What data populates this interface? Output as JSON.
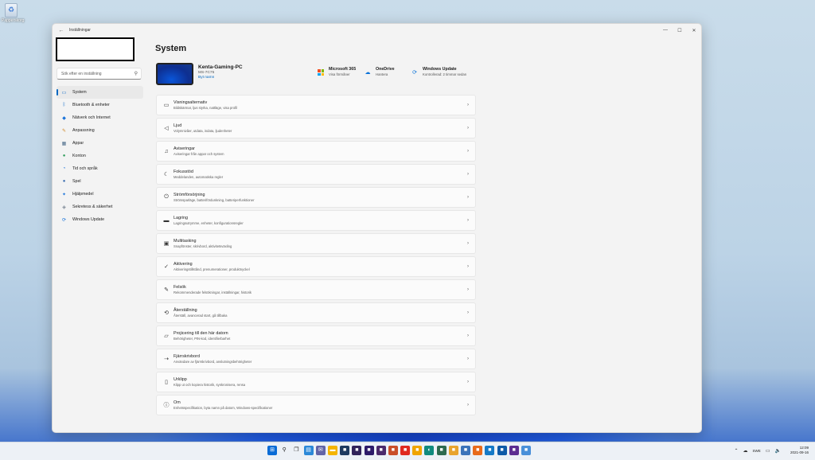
{
  "desktop": {
    "recycle_bin_label": "Papperskorg"
  },
  "window": {
    "title": "Inställningar",
    "controls": {
      "minimize": "—",
      "maximize": "☐",
      "close": "✕"
    }
  },
  "search": {
    "placeholder": "Sök efter en inställning"
  },
  "sidebar": {
    "items": [
      {
        "label": "System",
        "icon": "system-icon",
        "active": true
      },
      {
        "label": "Bluetooth & enheter",
        "icon": "bluetooth-icon"
      },
      {
        "label": "Nätverk och Internet",
        "icon": "wifi-icon"
      },
      {
        "label": "Anpassning",
        "icon": "brush-icon"
      },
      {
        "label": "Appar",
        "icon": "apps-icon"
      },
      {
        "label": "Konton",
        "icon": "account-icon"
      },
      {
        "label": "Tid och språk",
        "icon": "globe-clock-icon"
      },
      {
        "label": "Spel",
        "icon": "gaming-icon"
      },
      {
        "label": "Hjälpmedel",
        "icon": "accessibility-icon"
      },
      {
        "label": "Sekretess & säkerhet",
        "icon": "shield-icon"
      },
      {
        "label": "Windows Update",
        "icon": "windows-update-icon"
      }
    ]
  },
  "main": {
    "title": "System",
    "device": {
      "name": "Kenta-Gaming-PC",
      "model": "MS-7C75",
      "rename_link": "Byt namn"
    },
    "quick_links": [
      {
        "title": "Microsoft 365",
        "subtitle": "Visa förmåner",
        "icon": "microsoft365-icon"
      },
      {
        "title": "OneDrive",
        "subtitle": "Hantera",
        "icon": "onedrive-icon"
      },
      {
        "title": "Windows Update",
        "subtitle": "Kontrollerad: 2 timmar sedan",
        "icon": "windows-update-icon"
      }
    ],
    "settings": [
      {
        "title": "Visningsalternativ",
        "subtitle": "Bildskärmar, ljus styrka, nattläge, visa profil",
        "icon": "display-icon"
      },
      {
        "title": "Ljud",
        "subtitle": "Volymnivåer, utdata, indata, ljudenheter",
        "icon": "speaker-icon"
      },
      {
        "title": "Aviseringar",
        "subtitle": "Aviseringar från appar och system",
        "icon": "bell-icon"
      },
      {
        "title": "Fokusstöd",
        "subtitle": "Meddelanden, automatiska regler",
        "icon": "moon-icon"
      },
      {
        "title": "Strömförsörjning",
        "subtitle": "Strömsparläge, batterifördunkning, batteriperfunktioner",
        "icon": "power-icon"
      },
      {
        "title": "Lagring",
        "subtitle": "Lagringsutrymme, enheter, konfigurationsregler",
        "icon": "storage-icon"
      },
      {
        "title": "Multitasking",
        "subtitle": "Snapfönster, skrivbord, aktivitetsväxling",
        "icon": "multitasking-icon"
      },
      {
        "title": "Aktivering",
        "subtitle": "Aktiveringstillstånd, prenumerationer, produktnyckel",
        "icon": "check-circle-icon"
      },
      {
        "title": "Felsök",
        "subtitle": "Rekommenderade felsökningar, inställningar, historik",
        "icon": "wrench-icon"
      },
      {
        "title": "Återställning",
        "subtitle": "Återställ, avancerad start, gå tillbaka",
        "icon": "recovery-icon"
      },
      {
        "title": "Projicering till den här datorn",
        "subtitle": "Behörigheter, PIN-kod, identifierbarhet",
        "icon": "projection-icon"
      },
      {
        "title": "Fjärrskrivbord",
        "subtitle": "Användare av fjärrskrivbord, anslutningsbehörigheter",
        "icon": "remote-desktop-icon"
      },
      {
        "title": "Urklipp",
        "subtitle": "Klipp ut och kopiera historik, synkronisera, rensa",
        "icon": "clipboard-icon"
      },
      {
        "title": "Om",
        "subtitle": "Enhetsspecifikation, byta namn på datorn, Windows-specifikationer",
        "icon": "info-icon"
      }
    ]
  },
  "taskbar": {
    "apps": [
      {
        "icon": "start-icon",
        "color": "#0a6cd6"
      },
      {
        "icon": "search-icon",
        "color": "#222222"
      },
      {
        "icon": "task-view-icon",
        "color": "#333333"
      },
      {
        "icon": "widgets-icon",
        "color": "#2b88d8"
      },
      {
        "icon": "chat-icon",
        "color": "#6264a7"
      },
      {
        "icon": "file-explorer-icon",
        "color": "#f4b400"
      },
      {
        "icon": "app-icon",
        "color": "#1e3a5f"
      },
      {
        "icon": "app-icon",
        "color": "#31235a"
      },
      {
        "icon": "app-icon",
        "color": "#2d1b69"
      },
      {
        "icon": "app-icon",
        "color": "#4b2a6b"
      },
      {
        "icon": "app-icon",
        "color": "#c94f2a"
      },
      {
        "icon": "app-icon",
        "color": "#e02a20"
      },
      {
        "icon": "app-icon",
        "color": "#f0a500"
      },
      {
        "icon": "edge-icon",
        "color": "#0f8a7e"
      },
      {
        "icon": "app-icon",
        "color": "#2d6a4f"
      },
      {
        "icon": "app-icon",
        "color": "#e8a42e"
      },
      {
        "icon": "app-icon",
        "color": "#3b73b9"
      },
      {
        "icon": "app-icon",
        "color": "#e86b1c"
      },
      {
        "icon": "app-icon",
        "color": "#1479c7"
      },
      {
        "icon": "app-icon",
        "color": "#0e5aa7"
      },
      {
        "icon": "app-icon",
        "color": "#5c2d91"
      },
      {
        "icon": "app-icon",
        "color": "#4a90d9"
      }
    ],
    "tray": {
      "language": "SWE",
      "time": "12:09",
      "date": "2021-09-16"
    }
  }
}
